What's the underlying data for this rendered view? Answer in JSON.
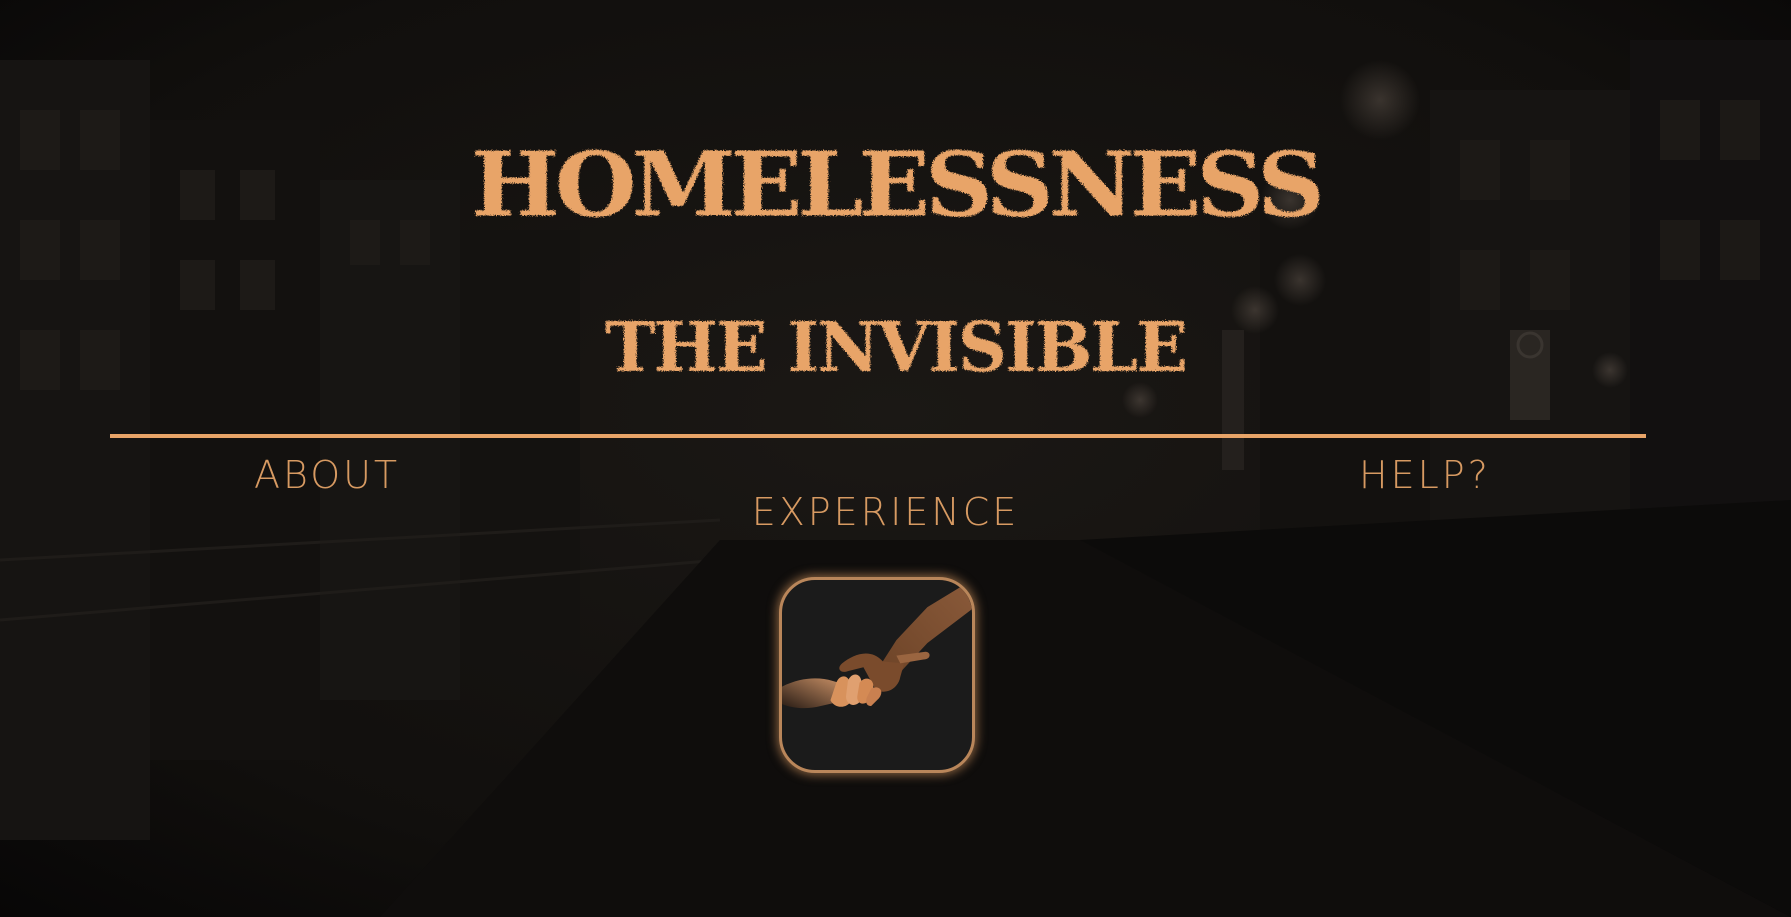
{
  "header": {
    "title": "HOMELESSNESS",
    "subtitle": "THE INVISIBLE"
  },
  "nav": {
    "about": "ABOUT",
    "experience": "EXPERIENCE",
    "help": "HELP?"
  },
  "icons": {
    "experience_icon": "helping-hands-icon"
  },
  "colors": {
    "accent": "#e8a468",
    "nav_text": "#d79a62",
    "background": "#0b0a09",
    "icon_bg": "#1b1b1b"
  }
}
